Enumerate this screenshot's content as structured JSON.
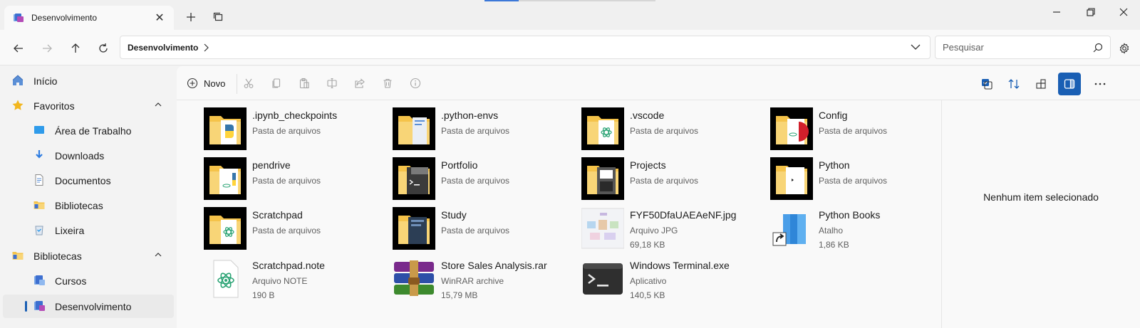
{
  "window": {
    "tab_title": "Desenvolvimento"
  },
  "address": {
    "crumb": "Desenvolvimento"
  },
  "search": {
    "placeholder": "Pesquisar"
  },
  "sidebar": {
    "items": [
      {
        "label": "Início",
        "icon": "home-icon"
      },
      {
        "label": "Favoritos",
        "icon": "star-icon"
      },
      {
        "label": "Área de Trabalho",
        "icon": "desktop-icon"
      },
      {
        "label": "Downloads",
        "icon": "download-icon"
      },
      {
        "label": "Documentos",
        "icon": "documents-icon"
      },
      {
        "label": "Bibliotecas",
        "icon": "library-folder-icon"
      },
      {
        "label": "Lixeira",
        "icon": "recycle-bin-icon"
      },
      {
        "label": "Bibliotecas",
        "icon": "library-folder-icon"
      },
      {
        "label": "Cursos",
        "icon": "library-icon"
      },
      {
        "label": "Desenvolvimento",
        "icon": "library-icon"
      }
    ]
  },
  "toolbar": {
    "new_label": "Novo"
  },
  "files": [
    {
      "name": ".ipynb_checkpoints",
      "type": "Pasta de arquivos",
      "size": "",
      "icon": "folder-python-icon"
    },
    {
      "name": ".python-envs",
      "type": "Pasta de arquivos",
      "size": "",
      "icon": "folder-icon"
    },
    {
      "name": ".vscode",
      "type": "Pasta de arquivos",
      "size": "",
      "icon": "folder-atom-icon"
    },
    {
      "name": "Config",
      "type": "Pasta de arquivos",
      "size": "",
      "icon": "folder-red-icon"
    },
    {
      "name": "pendrive",
      "type": "Pasta de arquivos",
      "size": "",
      "icon": "folder-python-icon"
    },
    {
      "name": "Portfolio",
      "type": "Pasta de arquivos",
      "size": "",
      "icon": "folder-terminal-icon"
    },
    {
      "name": "Projects",
      "type": "Pasta de arquivos",
      "size": "",
      "icon": "folder-dark-icon"
    },
    {
      "name": "Python",
      "type": "Pasta de arquivos",
      "size": "",
      "icon": "folder-icon"
    },
    {
      "name": "Scratchpad",
      "type": "Pasta de arquivos",
      "size": "",
      "icon": "folder-atom-icon"
    },
    {
      "name": "Study",
      "type": "Pasta de arquivos",
      "size": "",
      "icon": "folder-dark-icon"
    },
    {
      "name": "FYF50DfaUAEAeNF.jpg",
      "type": "Arquivo JPG",
      "size": "69,18 KB",
      "icon": "image-thumbnail-icon"
    },
    {
      "name": "Python Books",
      "type": "Atalho",
      "size": "1,86 KB",
      "icon": "shortcut-books-icon"
    },
    {
      "name": "Scratchpad.note",
      "type": "Arquivo NOTE",
      "size": "190 B",
      "icon": "atom-file-icon"
    },
    {
      "name": "Store Sales Analysis.rar",
      "type": "WinRAR archive",
      "size": "15,79 MB",
      "icon": "winrar-icon"
    },
    {
      "name": "Windows Terminal.exe",
      "type": "Aplicativo",
      "size": "140,5 KB",
      "icon": "terminal-icon"
    }
  ],
  "details": {
    "message": "Nenhum item selecionado"
  },
  "colors": {
    "accent": "#1a5fb4",
    "folder": "#f5d07a"
  }
}
